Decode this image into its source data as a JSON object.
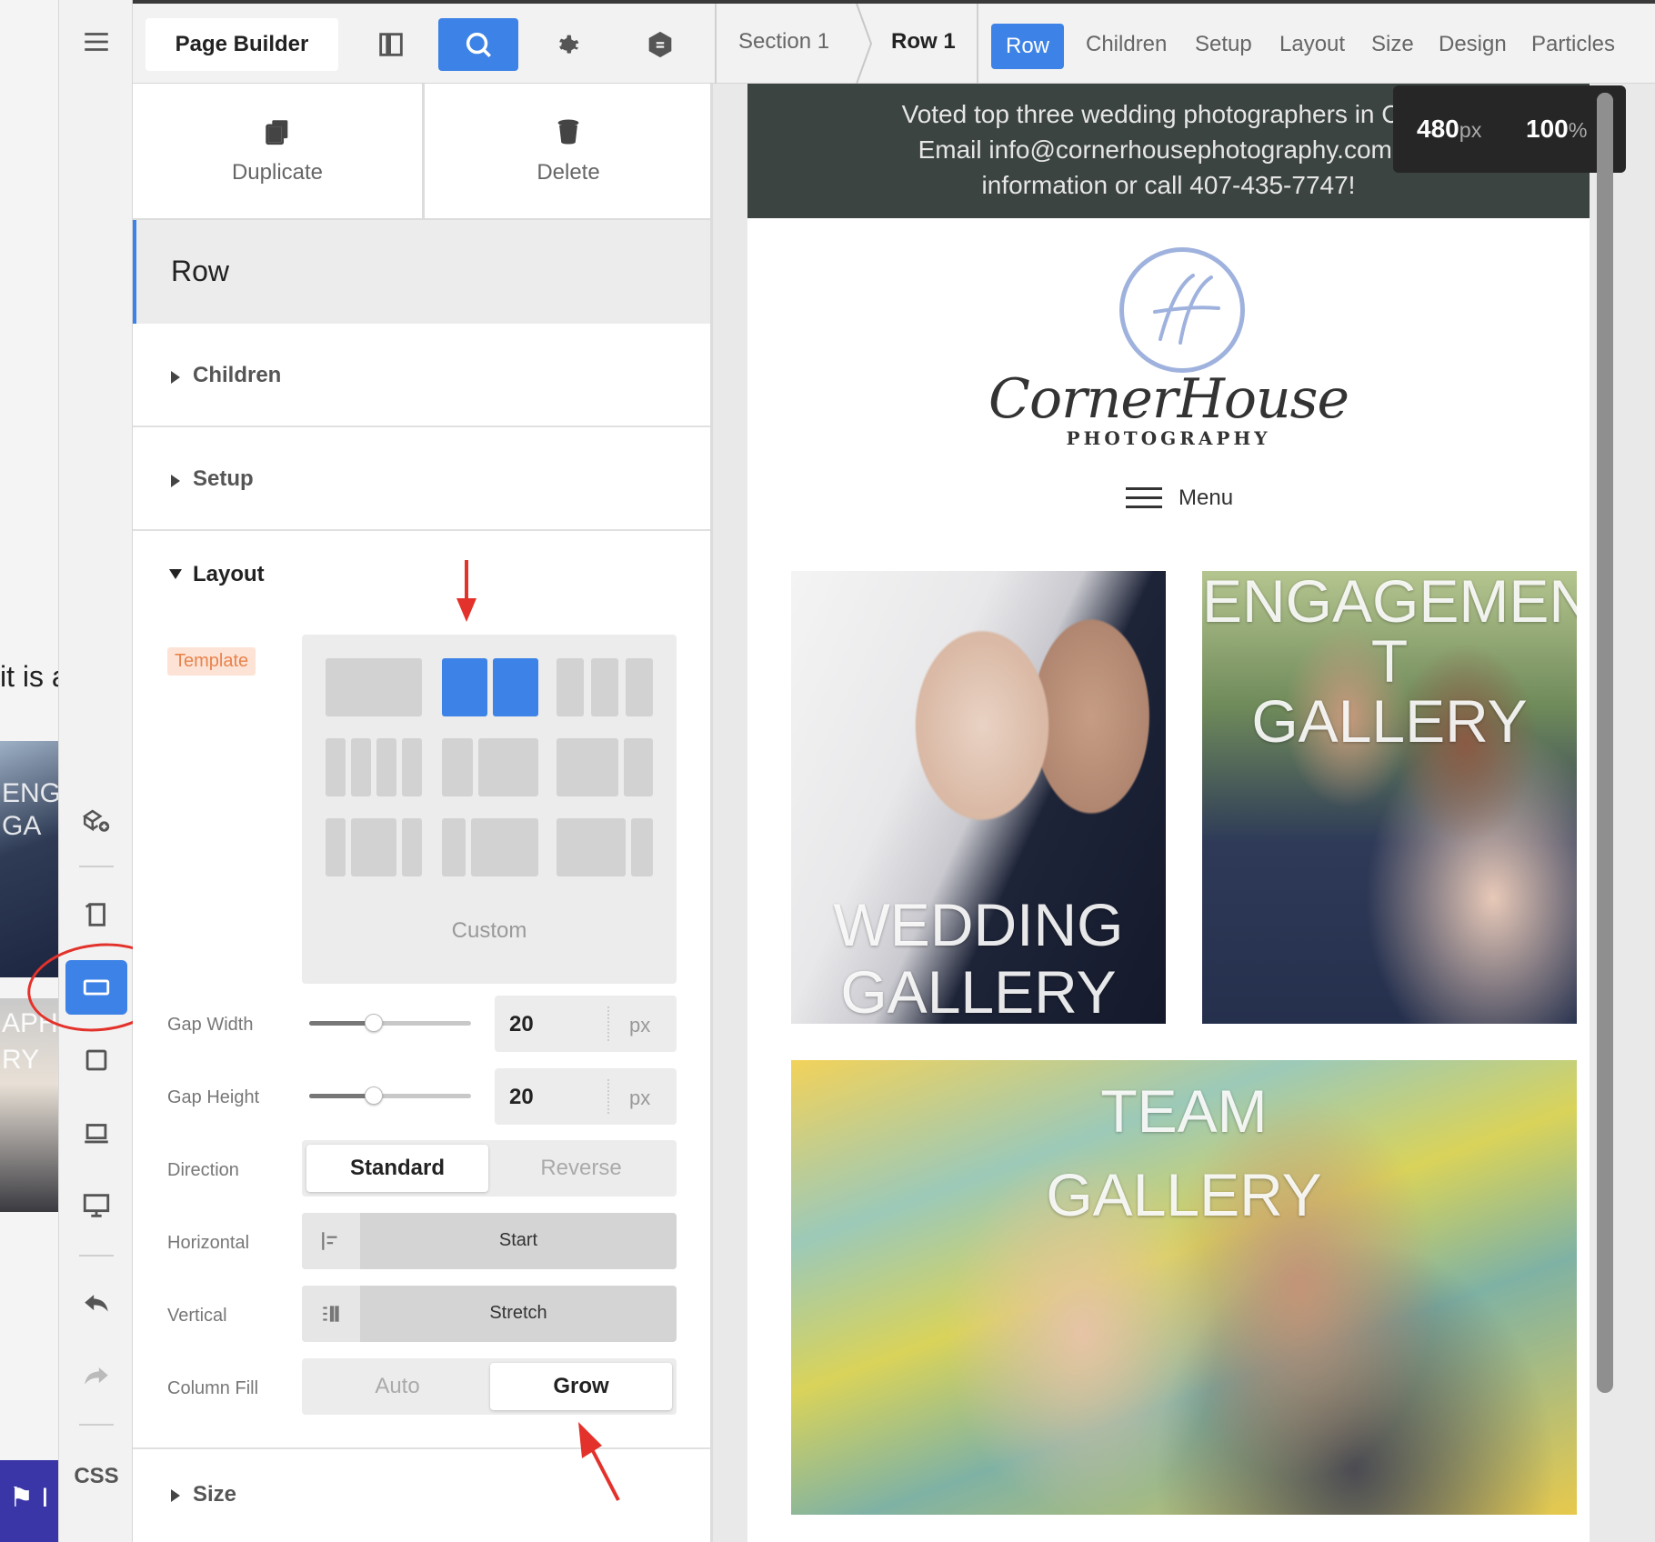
{
  "background_peek": {
    "text": "it is a",
    "photo1_caption": "ENG\nGA",
    "photo2_caption": "APH\nRY",
    "bar_text": "⚑ I"
  },
  "rail": {
    "icons": [
      "menu-icon",
      "add-element-icon",
      "page-icon",
      "row-layout-icon",
      "square-icon",
      "laptop-icon",
      "desktop-icon",
      "undo-icon",
      "redo-icon"
    ],
    "css_label": "CSS",
    "active_color": "#3d82e6"
  },
  "toolbar": {
    "title": "Page Builder",
    "breadcrumbs": [
      "Section 1",
      "Row 1"
    ],
    "active_tab": "Row",
    "tabs": [
      "Children",
      "Setup",
      "Layout",
      "Size",
      "Design",
      "Particles"
    ]
  },
  "panel": {
    "actions": {
      "duplicate": "Duplicate",
      "delete": "Delete"
    },
    "header": "Row",
    "sections": {
      "children": "Children",
      "setup": "Setup",
      "layout": "Layout",
      "size": "Size"
    },
    "layout": {
      "template_label": "Template",
      "template_custom": "Custom",
      "gap_width": {
        "label": "Gap Width",
        "value": "20",
        "unit": "px",
        "slider_level": 0.4
      },
      "gap_height": {
        "label": "Gap Height",
        "value": "20",
        "unit": "px",
        "slider_level": 0.4
      },
      "direction": {
        "label": "Direction",
        "options": [
          "Standard",
          "Reverse"
        ],
        "selected": "Standard"
      },
      "horizontal": {
        "label": "Horizontal",
        "value": "Start"
      },
      "vertical": {
        "label": "Vertical",
        "value": "Stretch"
      },
      "column_fill": {
        "label": "Column Fill",
        "options": [
          "Auto",
          "Grow"
        ],
        "selected": "Grow"
      }
    }
  },
  "preview": {
    "topbar_lines": [
      "Voted top three wedding photographers in Cent",
      "Email info@cornerhousephotography.com fc",
      "information or call 407-435-7747!"
    ],
    "viewport_width": "480",
    "viewport_width_unit": "px",
    "zoom": "100",
    "zoom_unit": "%",
    "logo_script": "CornerHouse",
    "logo_sub": "PHOTOGRAPHY",
    "menu_label": "Menu",
    "galleries": {
      "wedding": "WEDDING\nGALLERY",
      "engagement": "ENGAGEMEN\nT\nGALLERY",
      "team": "TEAM\nGALLERY"
    }
  },
  "colors": {
    "accent": "#3d82e6",
    "annotation": "#e3322b",
    "topbar": "#3b4440",
    "template_badge": "#e8834d"
  }
}
